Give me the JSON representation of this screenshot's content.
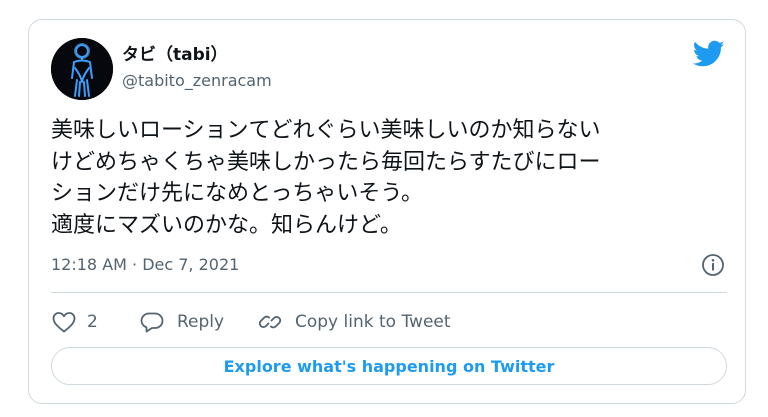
{
  "author": {
    "display_name": "タビ（tabi）",
    "handle": "@tabito_zenracam",
    "avatar_icon": "neon-figure-avatar"
  },
  "brand": {
    "logo_icon": "twitter-bird-icon",
    "accent_color": "#1d9bf0"
  },
  "tweet": {
    "text": "美味しいローションてどれぐらい美味しいのか知らない\nけどめちゃくちゃ美味しかったら毎回たらすたびにロー\nションだけ先になめとっちゃいそう。\n適度にマズいのかな。知らんけど。",
    "timestamp": "12:18 AM · Dec 7, 2021"
  },
  "actions": {
    "like_count": "2",
    "reply_label": "Reply",
    "copy_link_label": "Copy link to Tweet"
  },
  "explore": {
    "label": "Explore what's happening on Twitter"
  },
  "colors": {
    "text_primary": "#0f1419",
    "text_secondary": "#536471",
    "border": "#cfd9de"
  }
}
